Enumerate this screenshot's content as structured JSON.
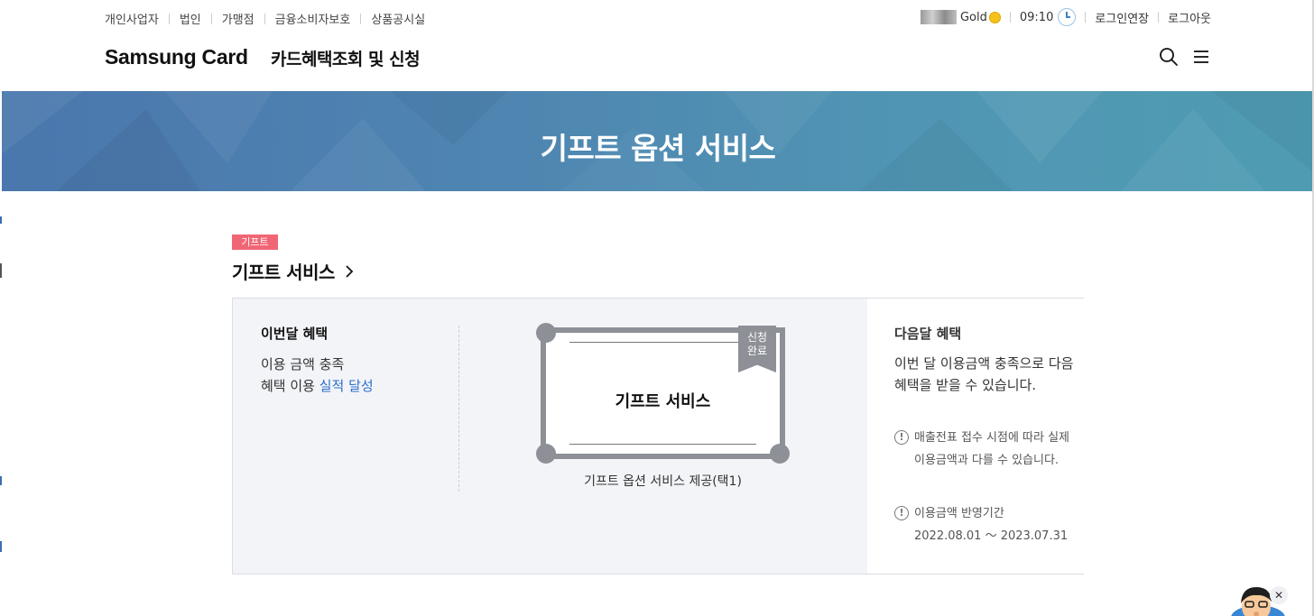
{
  "util_nav": {
    "left_items": [
      "개인사업자",
      "법인",
      "가맹점",
      "금융소비자보호",
      "상품공시실"
    ],
    "grade": "Gold",
    "time": "09:10",
    "extend_login": "로그인연장",
    "logout": "로그아웃"
  },
  "header": {
    "logo": "Samsung Card",
    "page_name": "카드혜택조회 및 신청"
  },
  "hero": {
    "title": "기프트 옵션 서비스"
  },
  "section": {
    "tag": "기프트",
    "title": "기프트 서비스"
  },
  "this_month": {
    "title": "이번달 혜택",
    "line1": "이용 금액 충족",
    "line2_prefix": "혜택 이용 ",
    "line2_highlight": "실적 달성"
  },
  "gift_card": {
    "label": "기프트 서비스",
    "ribbon_line1": "신청",
    "ribbon_line2": "완료",
    "caption": "기프트 옵션 서비스 제공(택1)"
  },
  "next_month": {
    "title": "다음달 혜택",
    "body": "이번 달 이용금액 충족으로 다음 혜택을 받을 수 있습니다.",
    "note1": "매출전표 접수 시점에 따라 실제 이용금액과 다를 수 있습니다.",
    "note2_label": "이용금액 반영기간",
    "note2_period": "2022.08.01 ～ 2023.07.31"
  },
  "colors": {
    "tag_bg": "#f16675",
    "highlight": "#2a6ecb",
    "card_gray": "#8e9097",
    "hero_blue": "#4f86b1"
  },
  "icons": [
    "search-icon",
    "menu-icon",
    "clock-icon",
    "coin-icon",
    "chevron-right-icon",
    "info-icon",
    "close-icon"
  ]
}
